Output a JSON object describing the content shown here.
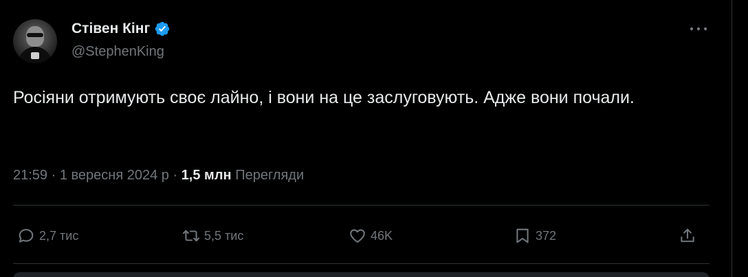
{
  "author": {
    "display_name": "Стівен Кінг",
    "handle": "@StephenKing",
    "verified": true
  },
  "tweet": {
    "text": "Росіяни отримують своє лайно, і вони на це заслуговують. Адже вони почали.",
    "time": "21:59",
    "date": "1 вересня 2024 р",
    "views_count": "1,5 млн",
    "views_label": "Перегляди"
  },
  "actions": {
    "replies": "2,7 тис",
    "reposts": "5,5 тис",
    "likes": "46K",
    "bookmarks": "372"
  },
  "colors": {
    "background": "#000000",
    "text": "#e7e9ea",
    "muted": "#71767b",
    "verified": "#1d9bf0",
    "divider": "#2f3336"
  },
  "icons": {
    "verified": "verified-badge-icon",
    "more": "more-icon",
    "reply": "reply-icon",
    "repost": "repost-icon",
    "like": "like-icon",
    "bookmark": "bookmark-icon",
    "share": "share-icon"
  }
}
